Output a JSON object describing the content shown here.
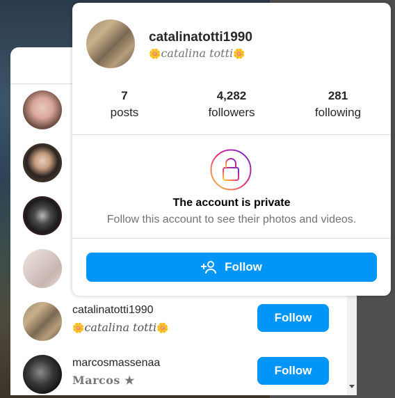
{
  "profile_card": {
    "username": "catalinatotti1990",
    "full_name": "catalina totti",
    "flower_glyph": "🌼",
    "stats": [
      {
        "value": "7",
        "label": "posts"
      },
      {
        "value": "4,282",
        "label": "followers"
      },
      {
        "value": "281",
        "label": "following"
      }
    ],
    "private_title": "The account is private",
    "private_subtitle": "Follow this account to see their photos and videos.",
    "follow_label": "Follow",
    "accent_color": "#0095f6"
  },
  "follower_list": {
    "rows": [
      {
        "username": "catalinatotti1990",
        "full_name": "catalina totti",
        "button": "Follow"
      },
      {
        "username": "marcosmassenaa",
        "full_name": "Marcos ★",
        "button": "Follow"
      }
    ]
  }
}
